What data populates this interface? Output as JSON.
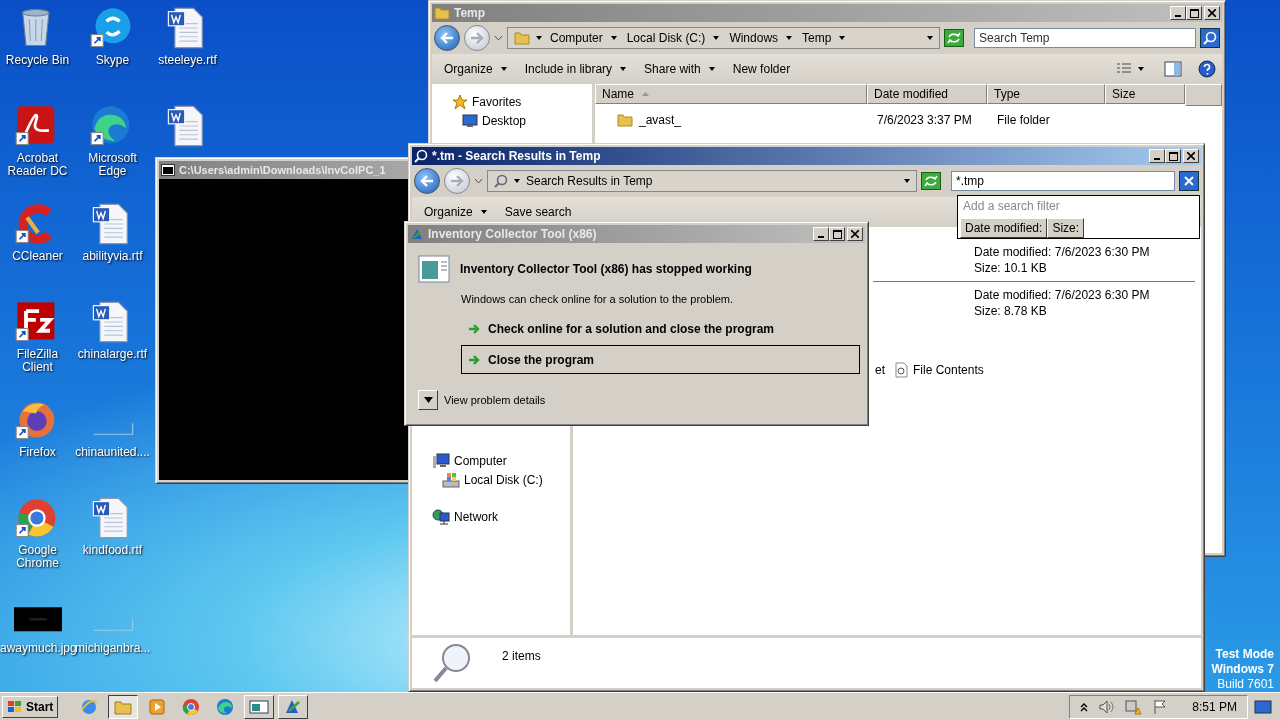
{
  "desktop_icon_columns": [
    [
      {
        "label": "Recycle Bin",
        "kind": "bin",
        "shortcut": false
      },
      {
        "label": "Acrobat Reader DC",
        "kind": "acrobat",
        "shortcut": true
      },
      {
        "label": "CCleaner",
        "kind": "ccleaner",
        "shortcut": true
      },
      {
        "label": "FileZilla Client",
        "kind": "filezilla",
        "shortcut": true
      },
      {
        "label": "Firefox",
        "kind": "firefox",
        "shortcut": true
      },
      {
        "label": "Google Chrome",
        "kind": "chrome",
        "shortcut": true
      },
      {
        "label": "awaymuch.jpg",
        "kind": "image",
        "shortcut": false
      }
    ],
    [
      {
        "label": "Skype",
        "kind": "skype",
        "shortcut": true
      },
      {
        "label": "Microsoft Edge",
        "kind": "edge",
        "shortcut": true
      },
      {
        "label": "abilityvia.rtf",
        "kind": "word",
        "shortcut": false
      },
      {
        "label": "chinalarge.rtf",
        "kind": "word",
        "shortcut": false
      },
      {
        "label": "chinaunited....",
        "kind": "blank",
        "shortcut": false
      },
      {
        "label": "kindfood.rtf",
        "kind": "word",
        "shortcut": false
      },
      {
        "label": "michiganbra...",
        "kind": "blank",
        "shortcut": false
      }
    ],
    [
      {
        "label": "steeleye.rtf",
        "kind": "word",
        "shortcut": false
      },
      {
        "kind": "word",
        "shortcut": false
      }
    ]
  ],
  "console_window": {
    "title": "C:\\Users\\admin\\Downloads\\InvColPC_1",
    "active": false
  },
  "temp_window": {
    "title": "Temp",
    "active": false,
    "breadcrumb": [
      "Computer",
      "Local Disk (C:)",
      "Windows",
      "Temp"
    ],
    "search": {
      "placeholder": "Search Temp"
    },
    "toolbar": [
      {
        "label": "Organize",
        "dropdown": true
      },
      {
        "label": "Include in library",
        "dropdown": true
      },
      {
        "label": "Share with",
        "dropdown": true
      },
      {
        "label": "New folder",
        "dropdown": false
      }
    ],
    "nav": [
      {
        "label": "Favorites",
        "kind": "star"
      },
      {
        "label": "Desktop",
        "kind": "desktop"
      }
    ],
    "columns": [
      "Name",
      "Date modified",
      "Type",
      "Size"
    ],
    "rows": [
      {
        "name": "_avast_",
        "date_modified": "7/6/2023 3:37 PM",
        "type": "File folder"
      }
    ]
  },
  "search_window": {
    "title": "*.tm - Search Results in Temp",
    "active": true,
    "location": "Search Results in Temp",
    "search": {
      "value": "*.tmp"
    },
    "filter_menu": {
      "hint": "Add a search filter",
      "filters": [
        "Date modified:",
        "Size:"
      ]
    },
    "toolbar": [
      {
        "label": "Organize",
        "dropdown": true
      },
      {
        "label": "Save search",
        "dropdown": false
      }
    ],
    "results": [
      {
        "date_modified": "Date modified: 7/6/2023 6:30 PM",
        "size": "Size: 10.1 KB"
      },
      {
        "date_modified": "Date modified: 7/6/2023 6:30 PM",
        "size": "Size: 8.78 KB"
      }
    ],
    "search_again": [
      {
        "label": "et",
        "kind": "text"
      },
      {
        "label": "File Contents",
        "kind": "link"
      }
    ],
    "nav": [
      {
        "label": "Computer",
        "kind": "computer",
        "children": [
          {
            "label": "Local Disk (C:)",
            "kind": "disk"
          }
        ]
      },
      {
        "label": "Network",
        "kind": "network"
      }
    ],
    "status": "2 items"
  },
  "error_dialog": {
    "title": "Inventory Collector Tool (x86)",
    "active": false,
    "heading": "Inventory Collector Tool (x86) has stopped working",
    "message": "Windows can check online for a solution to the problem.",
    "options": [
      {
        "label": "Check online for a solution and close the program",
        "selected": false
      },
      {
        "label": "Close the program",
        "selected": true
      }
    ],
    "details": "View problem details"
  },
  "watermark_text": [
    "Test Mode",
    "Windows 7",
    "Build 7601"
  ],
  "taskbar": {
    "start": "Start",
    "items": [
      {
        "kind": "ie",
        "open": false
      },
      {
        "kind": "explorer",
        "open": true
      },
      {
        "kind": "media",
        "open": false
      },
      {
        "kind": "chrome",
        "open": false
      },
      {
        "kind": "edge",
        "open": false
      },
      {
        "kind": "window",
        "open": true
      },
      {
        "kind": "tool",
        "open": true
      }
    ],
    "clock": "8:51 PM"
  }
}
